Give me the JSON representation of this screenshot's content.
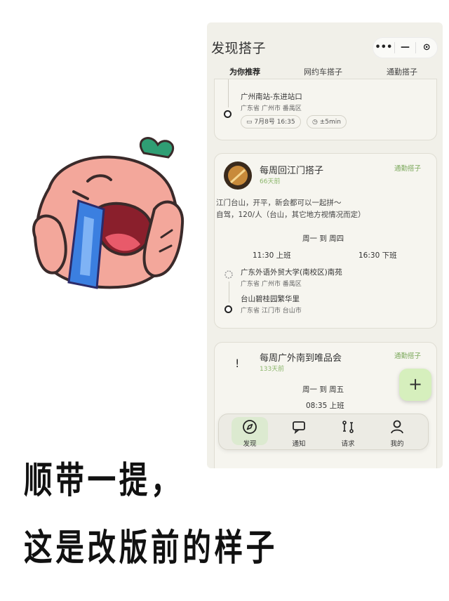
{
  "app": {
    "title": "发现搭子",
    "capsule": {
      "more": "•••",
      "minimize": "—",
      "close": "⊙"
    }
  },
  "tabs": [
    {
      "label": "为你推荐",
      "active": true
    },
    {
      "label": "网约车搭子",
      "active": false
    },
    {
      "label": "通勤搭子",
      "active": false
    }
  ],
  "card1": {
    "end_address": "广州南站-东进站口",
    "end_region": "广东省 广州市 番禺区",
    "date_pill": "7月8号 16:35",
    "time_pill": "±5min"
  },
  "card2": {
    "title": "每周回江门搭子",
    "ago": "66天前",
    "type": "通勤搭子",
    "desc_line1": "江门台山，开平，新会都可以一起拼～",
    "desc_line2": "自驾，120/人（台山，其它地方视情况而定）",
    "days": "周一 到 周四",
    "start_time": "11:30 上班",
    "end_time": "16:30 下班",
    "from_address": "广东外语外贸大学(南校区)南苑",
    "from_region": "广东省 广州市 番禺区",
    "to_address": "台山碧桂园繁华里",
    "to_region": "广东省 江门市 台山市"
  },
  "card3": {
    "title": "每周广外南到唯品会",
    "ago": "133天前",
    "type": "通勤搭子",
    "badge": "!",
    "days": "周一 到 周五",
    "start_time": "08:35 上班"
  },
  "fab": {
    "symbol": "+"
  },
  "bottom_nav": [
    {
      "label": "发现",
      "icon": "compass-icon",
      "active": true
    },
    {
      "label": "通知",
      "icon": "message-icon",
      "active": false
    },
    {
      "label": "请求",
      "icon": "route-icon",
      "active": false
    },
    {
      "label": "我的",
      "icon": "user-icon",
      "active": false
    }
  ],
  "caption": {
    "line1": "顺带一提，",
    "line2": "这是改版前的样子"
  },
  "colors": {
    "accent": "#8fc56d",
    "fab": "#d6efbd",
    "background": "#f1f0e9"
  }
}
